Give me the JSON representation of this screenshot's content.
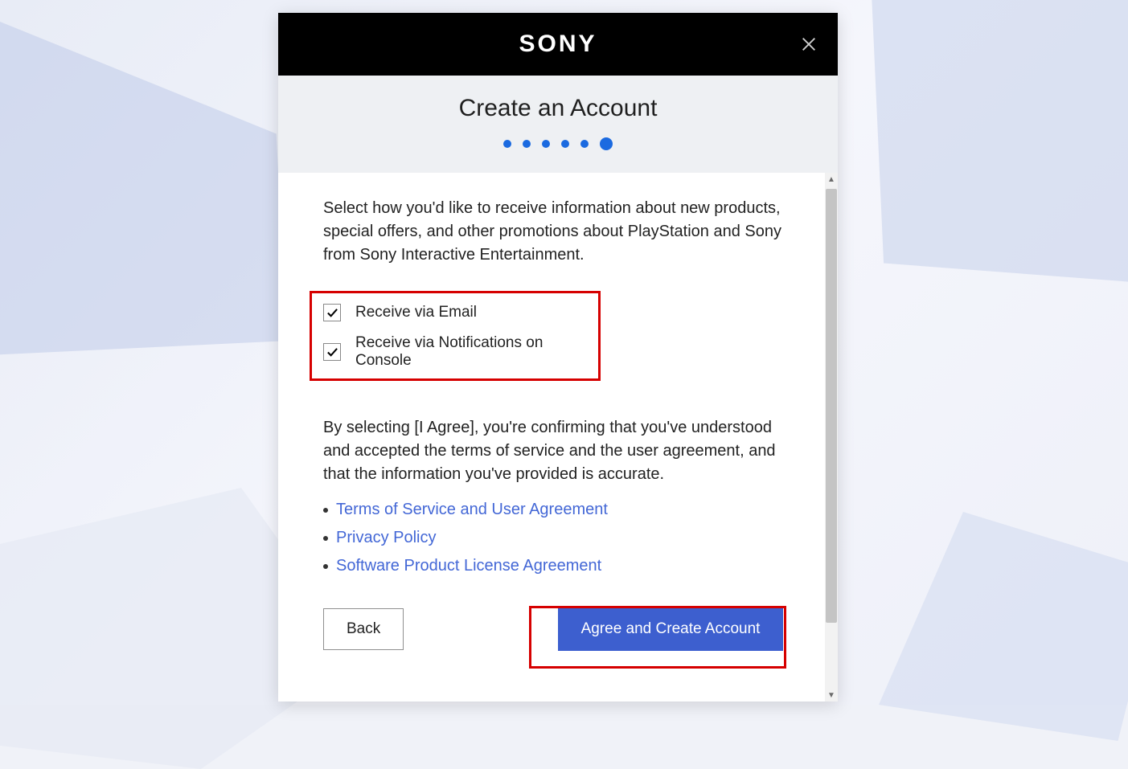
{
  "header": {
    "brand": "SONY",
    "close_icon": "close"
  },
  "title": "Create an Account",
  "progress": {
    "total": 6,
    "current": 6
  },
  "intro_text": "Select how you'd like to receive information about new products, special offers, and other promotions about PlayStation and Sony from Sony Interactive Entertainment.",
  "checkboxes": [
    {
      "label": "Receive via Email",
      "checked": true
    },
    {
      "label": "Receive via Notifications on Console",
      "checked": true
    }
  ],
  "agree_text": "By selecting [I Agree], you're confirming that you've understood and accepted the terms of service and the user agreement, and that the information you've provided is accurate.",
  "links": [
    "Terms of Service and User Agreement",
    "Privacy Policy",
    "Software Product License Agreement"
  ],
  "buttons": {
    "back": "Back",
    "primary": "Agree and Create Account"
  }
}
